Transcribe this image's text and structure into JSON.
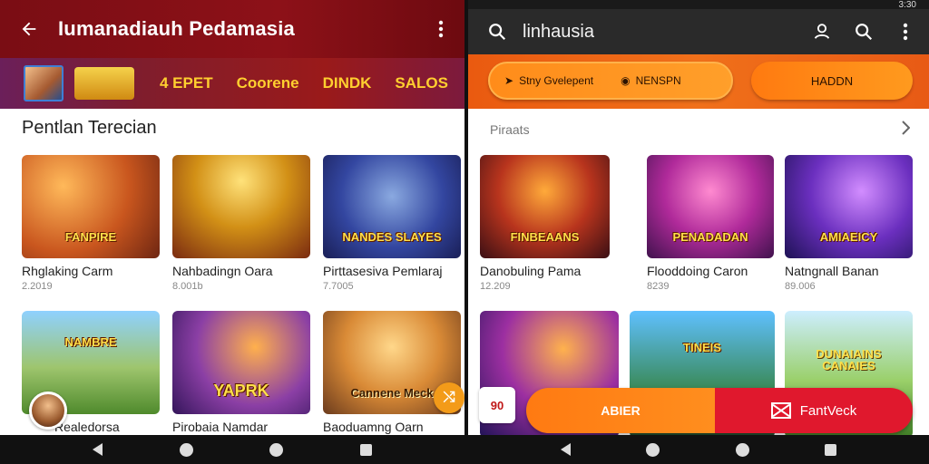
{
  "left": {
    "app_bar": {
      "title": "Iumanadiauh Pedamasia"
    },
    "tabs": [
      "4 EPET",
      "Coorene",
      "DINDK",
      "SALOS"
    ],
    "logo_text": "",
    "section_title": "Pentlan Terecian",
    "cards": [
      {
        "title": "Rhglaking Carm",
        "sub": "2.2019",
        "badge": "FANPIRE"
      },
      {
        "title": "Nahbadingn Oara",
        "sub": "8.001b",
        "badge": ""
      },
      {
        "title": "Pirttasesiva Pemlaraj",
        "sub": "7.7005",
        "badge": "NANDES SLAYES"
      },
      {
        "title": "Realedorsa",
        "sub": "",
        "badge": "NAMBRE"
      },
      {
        "title": "Pirobaia Namdar",
        "sub": "",
        "badge": "YAPRK"
      },
      {
        "title": "Baoduamng Oarn",
        "sub": "",
        "badge": "Cannene Meck"
      }
    ]
  },
  "right": {
    "status": {
      "time": "3:30"
    },
    "app_bar": {
      "title": "linhausia"
    },
    "band": {
      "pill1_left": "Stny Gvelepent",
      "pill1_right": "NENSPN",
      "pill2": "HADDN"
    },
    "section_title": "Piraats",
    "cards": [
      {
        "title": "Danobuling Pama",
        "sub": "12.209",
        "badge": "FINBEAANS"
      },
      {
        "title": "Flooddoing Caron",
        "sub": "8239",
        "badge": "PENADADAN"
      },
      {
        "title": "Natngnall Banan",
        "sub": "89.006",
        "badge": "AMIAEICY"
      },
      {
        "title": "",
        "sub": "",
        "badge": ""
      },
      {
        "title": "",
        "sub": "",
        "badge": "TINEIS"
      },
      {
        "title": "",
        "sub": "",
        "badge": "DUNAIAINS CANAIES"
      }
    ],
    "mini_icon_text": "90",
    "cta": {
      "primary": "ABIER",
      "secondary": "FantVeck"
    }
  }
}
